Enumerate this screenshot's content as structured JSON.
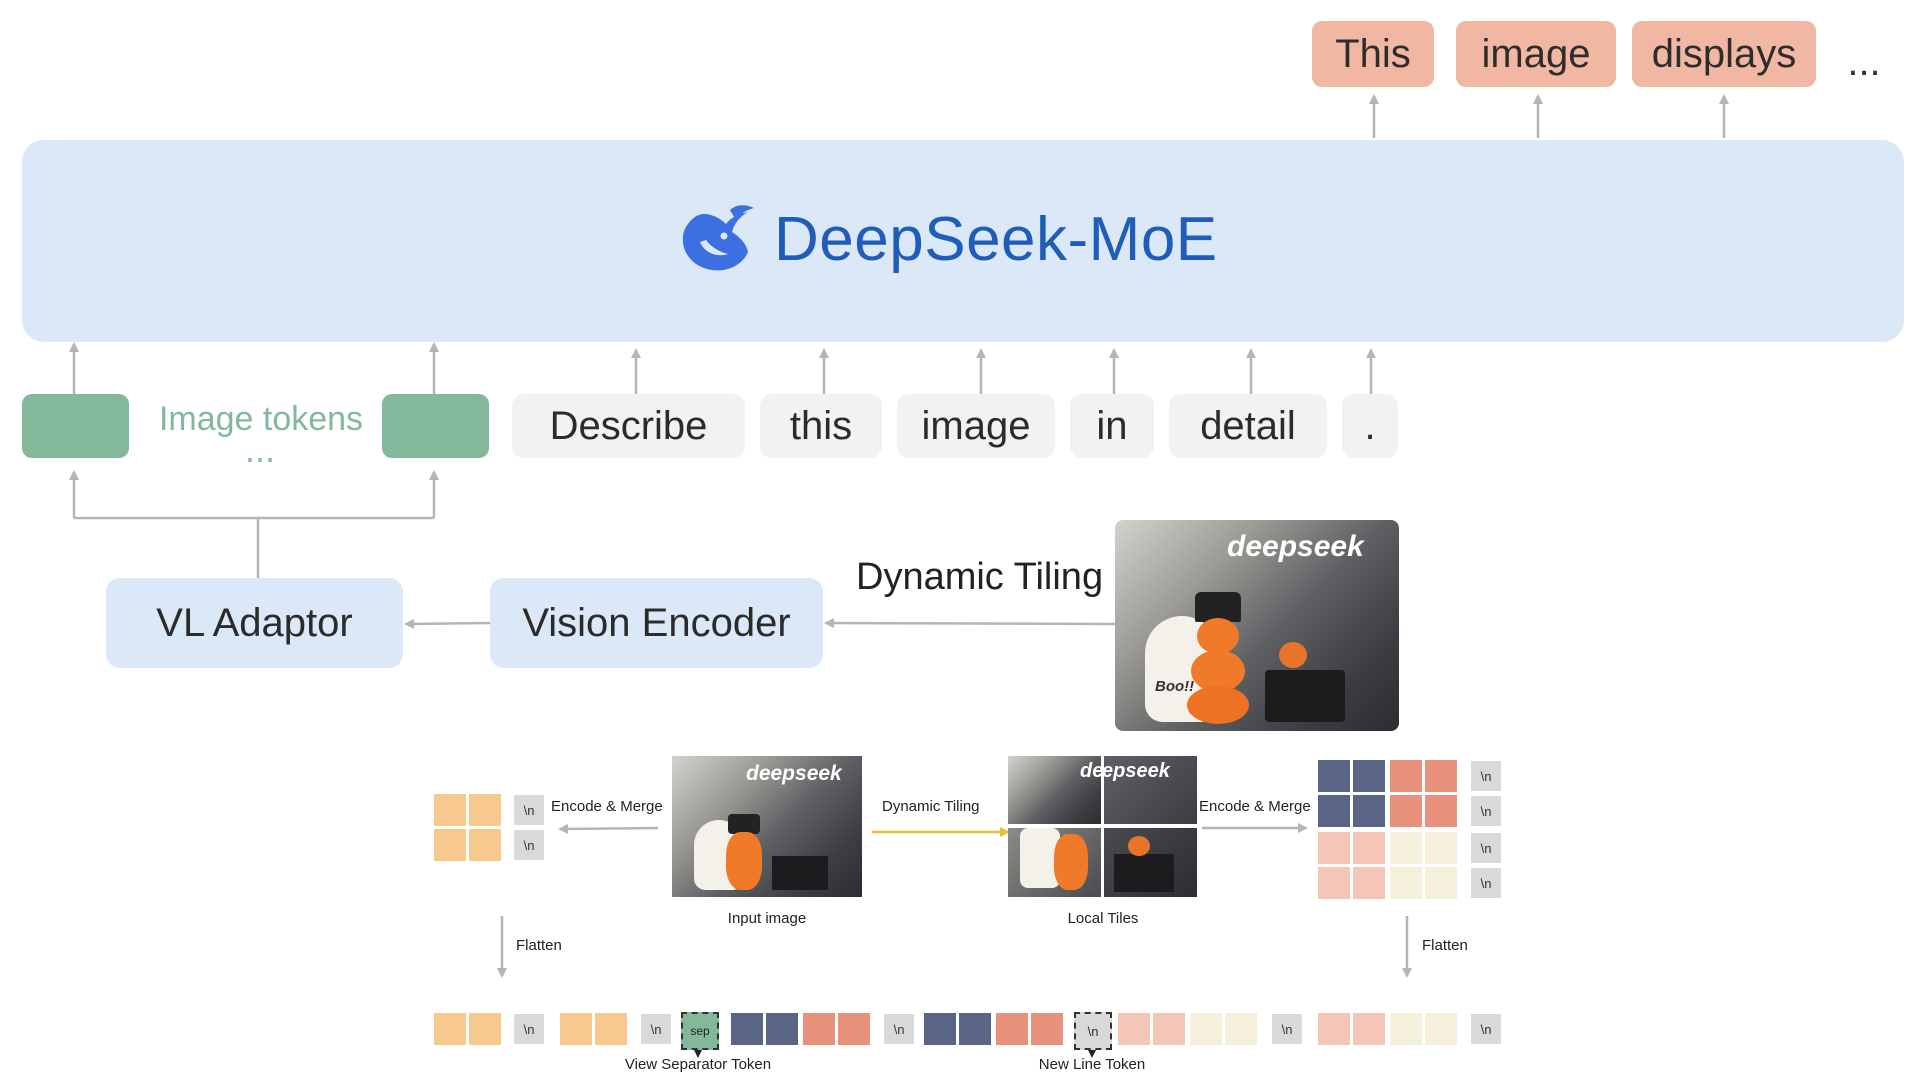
{
  "output_tokens": [
    "This",
    "image",
    "displays"
  ],
  "output_ellipsis": "...",
  "llm": {
    "title": "DeepSeek-MoE",
    "logo_icon": "whale-icon"
  },
  "image_tokens_label": "Image tokens",
  "image_tokens_dots": "...",
  "text_tokens": [
    "Describe",
    "this",
    "image",
    "in",
    "detail",
    "."
  ],
  "modules": {
    "vl_adaptor": "VL Adaptor",
    "vision_encoder": "Vision Encoder"
  },
  "dynamic_tiling_label": "Dynamic Tiling",
  "photo_brand": "deepseek",
  "photo_text": "Boo!!",
  "bottom": {
    "encode_merge_left": "Encode & Merge",
    "dynamic_tiling": "Dynamic Tiling",
    "encode_merge_right": "Encode & Merge",
    "input_image": "Input image",
    "local_tiles": "Local Tiles",
    "flatten_left": "Flatten",
    "flatten_right": "Flatten",
    "newline_symbol": "\\n",
    "sep_symbol": "sep",
    "view_separator_token": "View Separator Token",
    "new_line_token": "New Line Token"
  },
  "colors": {
    "output_token": "#f2b7a3",
    "llm_block": "#dbe8f7",
    "llm_text": "#1f5db8",
    "image_token": "#84b89b",
    "text_token": "#f2f2f2",
    "global_view": "#f7c98e",
    "tile_dark": "#5a6585",
    "tile_salmon": "#e8917d",
    "tile_pink": "#f3c6b8",
    "tile_cream": "#f5f0dc",
    "newline_token": "#d9d9d9",
    "tiling_arrow": "#f0c030"
  }
}
